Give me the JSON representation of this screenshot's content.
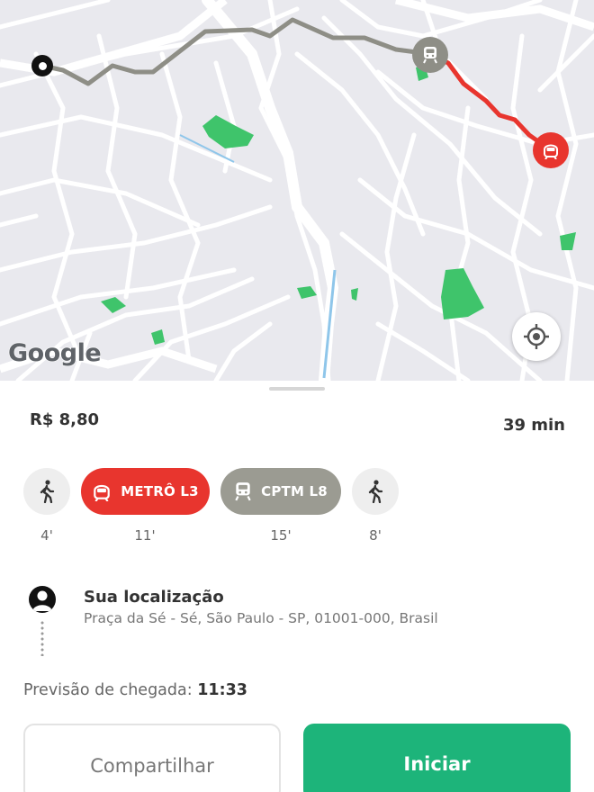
{
  "map": {
    "attribution": "Google",
    "locate_icon": "crosshair-icon",
    "route_colors": {
      "walk": "#8e8e86",
      "metro": "#e8352e"
    }
  },
  "summary": {
    "price": "R$ 8,80",
    "duration": "39 min"
  },
  "legs": [
    {
      "type": "walk",
      "icon": "walk-icon",
      "label": "",
      "time": "4'"
    },
    {
      "type": "metro",
      "icon": "metro-train-icon",
      "label": "METRÔ L3",
      "time": "11'",
      "color": "#e8352e"
    },
    {
      "type": "cptm",
      "icon": "train-icon",
      "label": "CPTM L8",
      "time": "15'",
      "color": "#9b9b92"
    },
    {
      "type": "walk",
      "icon": "walk-icon",
      "label": "",
      "time": "8'"
    }
  ],
  "origin": {
    "name": "Sua localização",
    "address": "Praça da Sé - Sé, São Paulo - SP, 01001-000, Brasil"
  },
  "arrival": {
    "label": "Previsão de chegada:",
    "time": "11:33"
  },
  "actions": {
    "share_label": "Compartilhar",
    "start_label": "Iniciar",
    "start_color": "#1db47a"
  }
}
